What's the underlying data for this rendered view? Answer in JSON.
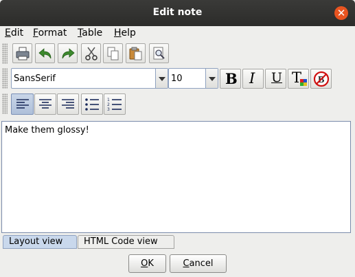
{
  "window": {
    "title": "Edit note",
    "close_glyph": "✕"
  },
  "menu": [
    {
      "label": "Edit",
      "mnemonic": "E",
      "rest": "dit"
    },
    {
      "label": "Format",
      "mnemonic": "F",
      "rest": "ormat"
    },
    {
      "label": "Table",
      "mnemonic": "T",
      "rest": "able"
    },
    {
      "label": "Help",
      "mnemonic": "H",
      "rest": "elp"
    }
  ],
  "toolbar1": [
    "print-icon",
    "undo-icon",
    "redo-icon",
    "cut-icon",
    "copy-icon",
    "paste-icon",
    "find-icon"
  ],
  "font": {
    "family": "SansSerif",
    "size": "10"
  },
  "format_buttons": {
    "bold": "B",
    "italic": "I",
    "underline": "U",
    "color": "T"
  },
  "editor": {
    "content": "Make them glossy!"
  },
  "tabs": {
    "layout": "Layout view",
    "html": "HTML Code view"
  },
  "buttons": {
    "ok": {
      "mnemonic": "O",
      "rest": "K"
    },
    "cancel": {
      "mnemonic": "C",
      "rest": "ancel"
    }
  },
  "colors": {
    "accent_close": "#e95420",
    "selected_tab": "#c9d8ec"
  }
}
